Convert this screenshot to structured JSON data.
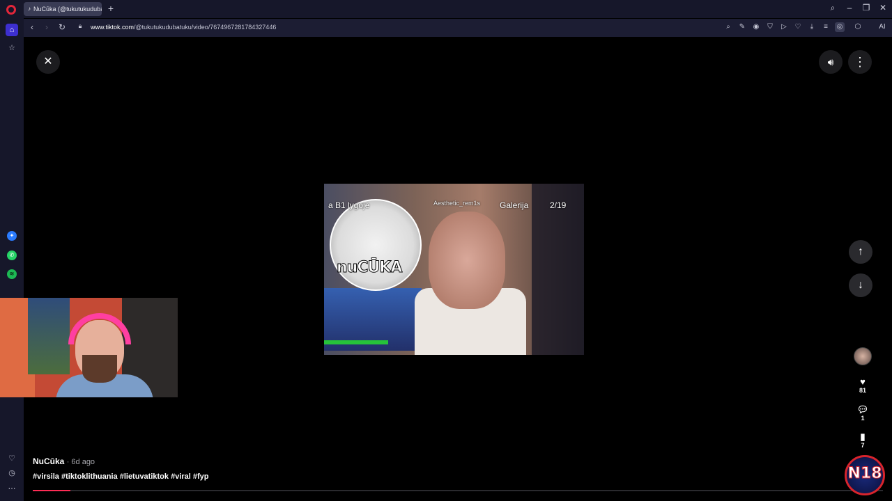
{
  "tab": {
    "title": "NuCūka (@tukutukuduba"
  },
  "address": {
    "host": "www.tiktok.com",
    "path": "/@tukutukudubatuku/video/7674967281784327446"
  },
  "video_overlay": {
    "top_left": "a B1 lygoje",
    "aesthetic": "Aesthetic_rem1s",
    "gallery": "Galerija",
    "counter": "2/19",
    "logo": "nuCŪKA"
  },
  "post": {
    "author": "NuCūka",
    "ago": "· 6d ago",
    "caption": "#virsila #tiktoklithuania #lietuvatiktok #viral #fyp",
    "progress": 0.044
  },
  "actions": {
    "likes": "81",
    "comments": "1",
    "saves": "7"
  },
  "badge": {
    "text": "N18"
  },
  "colors": {
    "accent": "#fe2c55",
    "sidebar_active": "#3d2fd0"
  }
}
